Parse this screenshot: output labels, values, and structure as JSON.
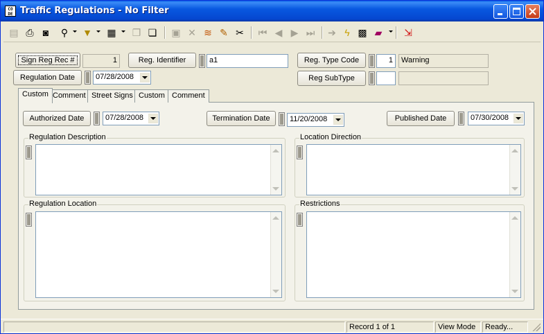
{
  "window": {
    "title": "Traffic Regulations - No Filter",
    "app_icon_text": "CO DE"
  },
  "header": {
    "sign_reg_rec_label": "Sign Reg Rec #",
    "sign_reg_rec_value": "1",
    "reg_identifier_label": "Reg. Identifier",
    "reg_identifier_value": "a1",
    "reg_type_code_label": "Reg. Type Code",
    "reg_type_code_value": "1",
    "reg_type_code_desc": "Warning",
    "regulation_date_label": "Regulation Date",
    "regulation_date_value": "07/28/2008",
    "reg_subtype_label": "Reg SubType",
    "reg_subtype_value": "",
    "reg_subtype_desc": ""
  },
  "tabs": [
    {
      "label": "Custom",
      "active": true
    },
    {
      "label": "Comment",
      "active": false
    },
    {
      "label": "Street Signs",
      "active": false
    },
    {
      "label": "Custom",
      "active": false
    },
    {
      "label": "Comment",
      "active": false
    }
  ],
  "custom_tab": {
    "authorized_date_label": "Authorized Date",
    "authorized_date_value": "07/28/2008",
    "termination_date_label": "Termination Date",
    "termination_date_value": "11/20/2008",
    "published_date_label": "Published Date",
    "published_date_value": "07/30/2008",
    "regulation_description_label": "Regulation Description",
    "regulation_description_value": "",
    "location_direction_label": "Location Direction",
    "location_direction_value": "",
    "regulation_location_label": "Regulation Location",
    "regulation_location_value": "",
    "restrictions_label": "Restrictions",
    "restrictions_value": ""
  },
  "status": {
    "record": "Record 1 of 1",
    "mode": "View Mode",
    "state": "Ready..."
  },
  "toolbar_icons": [
    "new-record-icon",
    "print-icon",
    "print-preview-icon",
    "binoculars-icon",
    "filter-icon",
    "view-icon",
    "copy-icon",
    "paste-icon",
    "save-icon",
    "delete-icon",
    "stack-icon",
    "edit-pencil-icon",
    "cut-icon",
    "first-record-icon",
    "previous-record-icon",
    "next-record-icon",
    "last-record-icon",
    "goto-icon",
    "lightning-icon",
    "image-icon",
    "book-icon",
    "exit-icon"
  ]
}
